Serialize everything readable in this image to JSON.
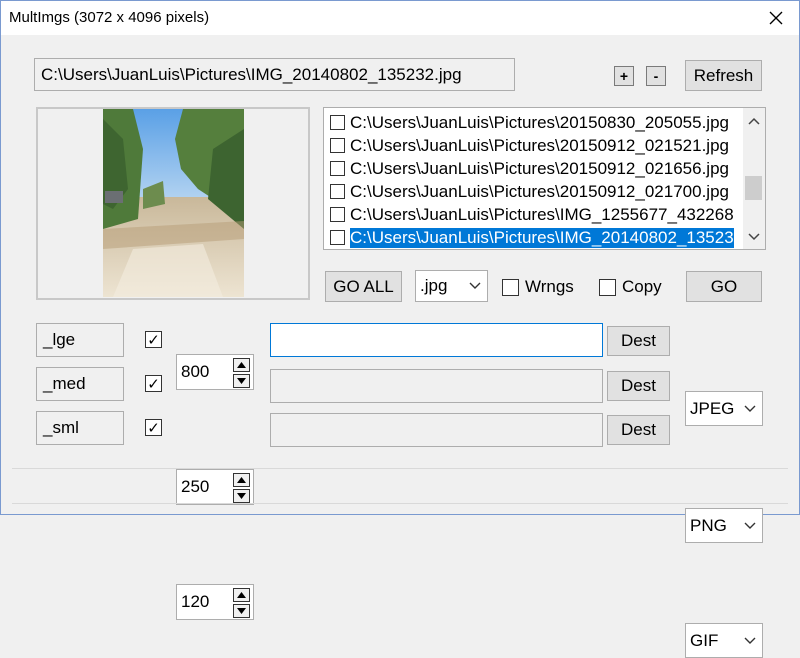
{
  "window": {
    "title": "MultImgs (3072 x 4096 pixels)",
    "close_icon": "close-icon"
  },
  "top": {
    "path": "C:\\Users\\JuanLuis\\Pictures\\IMG_20140802_135232.jpg",
    "plus_label": "+",
    "minus_label": "-",
    "refresh_label": "Refresh"
  },
  "file_list": {
    "items": [
      {
        "label": "C:\\Users\\JuanLuis\\Pictures\\20150830_205055.jpg",
        "checked": false,
        "selected": false
      },
      {
        "label": "C:\\Users\\JuanLuis\\Pictures\\20150912_021521.jpg",
        "checked": false,
        "selected": false
      },
      {
        "label": "C:\\Users\\JuanLuis\\Pictures\\20150912_021656.jpg",
        "checked": false,
        "selected": false
      },
      {
        "label": "C:\\Users\\JuanLuis\\Pictures\\20150912_021700.jpg",
        "checked": false,
        "selected": false
      },
      {
        "label": "C:\\Users\\JuanLuis\\Pictures\\IMG_1255677_432268",
        "checked": false,
        "selected": false
      },
      {
        "label": "C:\\Users\\JuanLuis\\Pictures\\IMG_20140802_13523",
        "checked": false,
        "selected": true
      }
    ]
  },
  "controls": {
    "go_all_label": "GO ALL",
    "ext_value": ".jpg",
    "warnings_label": "Wrngs",
    "copy_label": "Copy",
    "go_label": "GO"
  },
  "sizes": [
    {
      "suffix": "_lge",
      "checked": true,
      "size": "800",
      "dest_value": "",
      "dest_label": "Dest",
      "format": "JPEG"
    },
    {
      "suffix": "_med",
      "checked": true,
      "size": "250",
      "dest_value": "",
      "dest_label": "Dest",
      "format": "PNG"
    },
    {
      "suffix": "_sml",
      "checked": true,
      "size": "120",
      "dest_value": "",
      "dest_label": "Dest",
      "format": "GIF"
    }
  ],
  "check_glyph": "✓"
}
